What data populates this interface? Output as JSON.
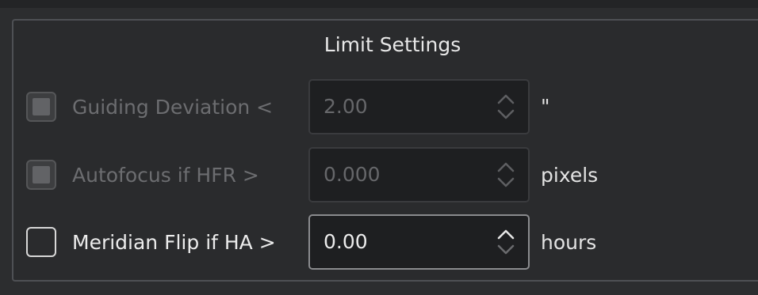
{
  "group": {
    "title": "Limit Settings"
  },
  "rows": [
    {
      "label": "Guiding Deviation <",
      "value": "2.00",
      "unit": "\"",
      "checked": false,
      "enabled": false
    },
    {
      "label": "Autofocus if HFR >",
      "value": "0.000",
      "unit": "pixels",
      "checked": false,
      "enabled": false
    },
    {
      "label": "Meridian Flip if HA >",
      "value": "0.00",
      "unit": "hours",
      "checked": false,
      "enabled": true
    }
  ],
  "icons": {
    "spin_up": "chevron-up-icon",
    "spin_down": "chevron-down-icon"
  },
  "colors": {
    "background": "#2a2b2d",
    "disabled_text": "#6c6d70",
    "enabled_text": "#ececec",
    "field_background": "#1e1f21"
  }
}
